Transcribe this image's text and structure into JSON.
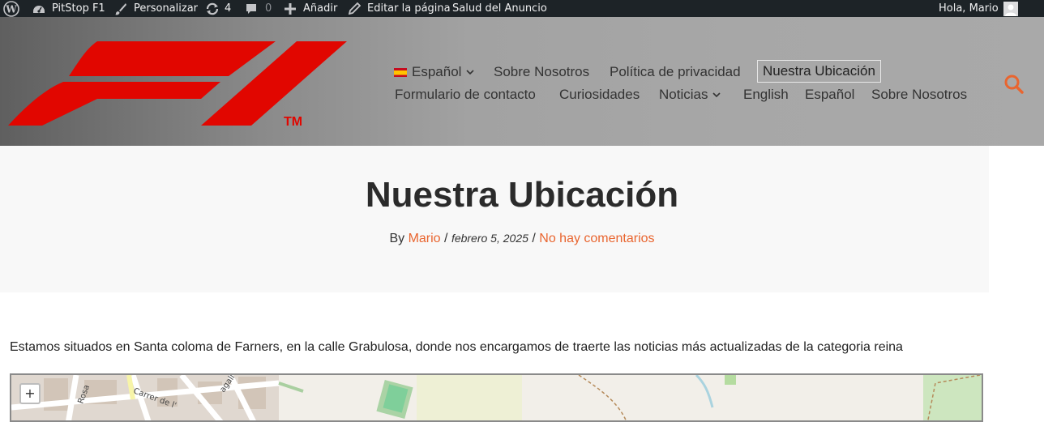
{
  "admin_bar": {
    "site_name": "PitStop F1",
    "customize": "Personalizar",
    "updates_count": "4",
    "comments_count": "0",
    "add_new": "Añadir",
    "edit_page": "Editar la página",
    "ad_health": "Salud del Anuncio",
    "greeting": "Hola, Mario"
  },
  "logo": {
    "alt_text": "F1",
    "trademark": "TM"
  },
  "nav": {
    "row1": [
      "Español",
      "Sobre Nosotros",
      "Política de privacidad",
      "Nuestra Ubicación"
    ],
    "row2": [
      "Formulario de contacto",
      "Curiosidades",
      "Noticias",
      "English",
      "Español",
      "Sobre Nosotros"
    ],
    "current": "Nuestra Ubicación"
  },
  "page": {
    "title": "Nuestra Ubicación",
    "by": "By",
    "author": "Mario",
    "separator": "/",
    "date": "febrero 5, 2025",
    "comments": "No hay comentarios",
    "body": "Estamos situados en Santa coloma de Farners, en la calle Grabulosa, donde nos encargamos de traerte las noticias más actualizadas de la categoria reina"
  },
  "map": {
    "zoom_in": "+",
    "street_labels": [
      "Rosa",
      "Carrer de l'",
      "agall"
    ]
  },
  "colors": {
    "accent": "#e9652f",
    "f1_red": "#e10600",
    "admin_bar_bg": "#1d2327"
  },
  "icons": [
    "wordpress-icon",
    "dashboard-icon",
    "brush-icon",
    "updates-icon",
    "comments-icon",
    "plus-icon",
    "pencil-icon",
    "avatar-icon",
    "chevron-down-icon",
    "search-icon"
  ]
}
